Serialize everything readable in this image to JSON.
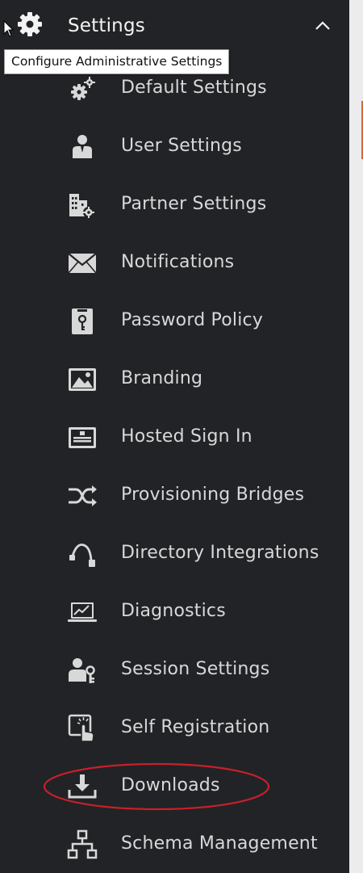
{
  "header": {
    "title": "Settings",
    "icon": "gear-icon",
    "chevron": "chevron-up-icon"
  },
  "tooltip": {
    "text": "Configure Administrative Settings"
  },
  "menu": {
    "items": [
      {
        "label": "Default Settings",
        "icon": "gears-icon"
      },
      {
        "label": "User Settings",
        "icon": "user-icon"
      },
      {
        "label": "Partner Settings",
        "icon": "building-gear-icon"
      },
      {
        "label": "Notifications",
        "icon": "envelope-icon"
      },
      {
        "label": "Password Policy",
        "icon": "key-badge-icon"
      },
      {
        "label": "Branding",
        "icon": "image-icon"
      },
      {
        "label": "Hosted Sign In",
        "icon": "signin-form-icon"
      },
      {
        "label": "Provisioning Bridges",
        "icon": "shuffle-icon"
      },
      {
        "label": "Directory Integrations",
        "icon": "connector-icon"
      },
      {
        "label": "Diagnostics",
        "icon": "laptop-chart-icon"
      },
      {
        "label": "Session Settings",
        "icon": "user-key-icon"
      },
      {
        "label": "Self Registration",
        "icon": "touch-icon"
      },
      {
        "label": "Downloads",
        "icon": "download-icon",
        "highlighted": true
      },
      {
        "label": "Schema Management",
        "icon": "hierarchy-icon"
      }
    ]
  },
  "colors": {
    "sidebar_bg": "#222326",
    "text": "#d8d8d8",
    "header_text": "#f3f3f3",
    "highlight_ring": "#c8202a",
    "accent": "#d2683a"
  }
}
